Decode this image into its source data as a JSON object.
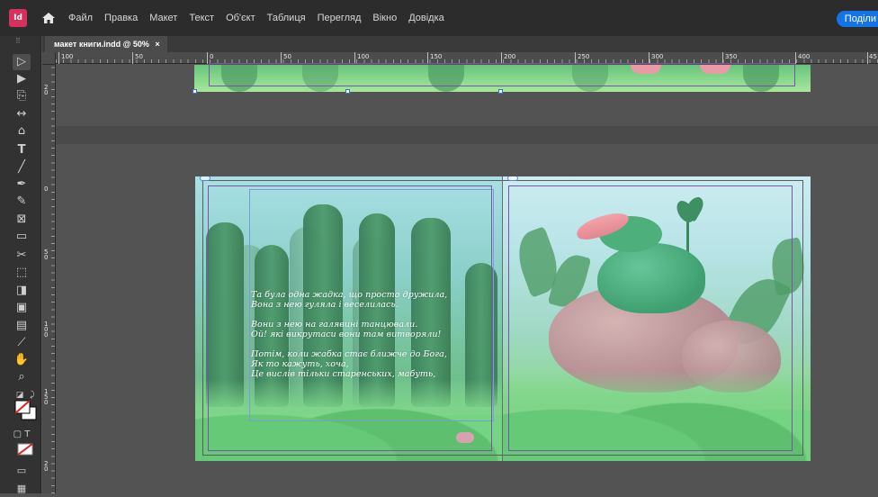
{
  "app": {
    "logo_text": "Id"
  },
  "menu": {
    "items": [
      "Файл",
      "Правка",
      "Макет",
      "Текст",
      "Об'єкт",
      "Таблиця",
      "Перегляд",
      "Вікно",
      "Довідка"
    ],
    "share_label": "Поділи"
  },
  "tab": {
    "title": "макет книги.indd @ 50%",
    "close": "×"
  },
  "ruler": {
    "h_labels": [
      "100",
      "50",
      "0",
      "50",
      "100",
      "150",
      "200",
      "250",
      "300",
      "350",
      "400",
      "45"
    ],
    "v_labels": [
      "2 0",
      "0",
      "5 0",
      "1 0 0",
      "1 5 0",
      "2 0"
    ]
  },
  "poem": {
    "stanzas": [
      [
        "Та була одна жадка, що просто дружила,",
        "Вона з нею гуляла і веселилась."
      ],
      [
        "Вони з нею на галявині танцювали.",
        "Ой! які викрутаси вони там витворяли!"
      ],
      [
        "Потім, коли жабка стає ближче до Бога,",
        "Як то кажуть, хоча,",
        "Це вислів тільки старенських, мабуть,"
      ]
    ]
  },
  "colors": {
    "accent": "#1473e6",
    "menubar": "#2c2c2c",
    "panel": "#323232",
    "pasteboard": "#535353",
    "logo": "#d6305d",
    "margin_guide": "#7a52a8"
  },
  "tools": [
    "selection-tool-icon",
    "direct-selection-tool-icon",
    "page-tool-icon",
    "gap-tool-icon",
    "content-collector-icon",
    "type-tool-icon",
    "line-tool-icon",
    "pen-tool-icon",
    "pencil-tool-icon",
    "rectangle-frame-tool-icon",
    "rectangle-tool-icon",
    "scissors-tool-icon",
    "free-transform-tool-icon",
    "gradient-swatch-tool-icon",
    "gradient-feather-tool-icon",
    "note-tool-icon",
    "eyedropper-tool-icon",
    "hand-tool-icon",
    "zoom-tool-icon",
    "default-fill-stroke-icon",
    "swap-fill-stroke-icon",
    "fill-stroke-swatch-icon",
    "formatting-affects-container-icon",
    "apply-none-icon",
    "screen-mode-icon",
    "preview-mode-icon"
  ]
}
